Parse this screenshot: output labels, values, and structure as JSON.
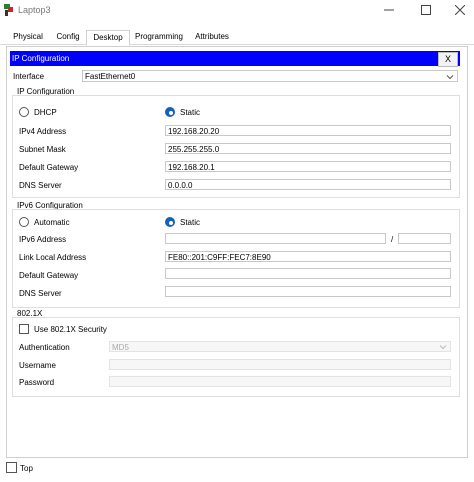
{
  "window": {
    "title": "Laptop3"
  },
  "tabs": [
    {
      "label": "Physical"
    },
    {
      "label": "Config"
    },
    {
      "label": "Desktop"
    },
    {
      "label": "Programming"
    },
    {
      "label": "Attributes"
    }
  ],
  "panel": {
    "title": "IP Configuration",
    "close_label": "X",
    "interface": {
      "label": "Interface",
      "value": "FastEthernet0"
    },
    "ipv4": {
      "section_label": "IP Configuration",
      "dhcp_label": "DHCP",
      "static_label": "Static",
      "selected": "Static",
      "fields": [
        {
          "label": "IPv4 Address",
          "value": "192.168.20.20"
        },
        {
          "label": "Subnet Mask",
          "value": "255.255.255.0"
        },
        {
          "label": "Default Gateway",
          "value": "192.168.20.1"
        },
        {
          "label": "DNS Server",
          "value": "0.0.0.0"
        }
      ]
    },
    "ipv6": {
      "section_label": "IPv6 Configuration",
      "automatic_label": "Automatic",
      "static_label": "Static",
      "selected": "Static",
      "prefix_separator": "/",
      "fields": [
        {
          "label": "IPv6 Address",
          "value": ""
        },
        {
          "label": "Link Local Address",
          "value": "FE80::201:C9FF:FEC7:8E90"
        },
        {
          "label": "Default Gateway",
          "value": ""
        },
        {
          "label": "DNS Server",
          "value": ""
        }
      ]
    },
    "dot1x": {
      "section_label": "802.1X",
      "use_label": "Use 802.1X Security",
      "checked": false,
      "auth_label": "Authentication",
      "auth_value": "MD5",
      "username_label": "Username",
      "password_label": "Password"
    }
  },
  "footer": {
    "top_label": "Top",
    "checked": false
  },
  "colors": {
    "title_bar_blue": "#0000ff",
    "radio_blue": "#1560bd"
  }
}
